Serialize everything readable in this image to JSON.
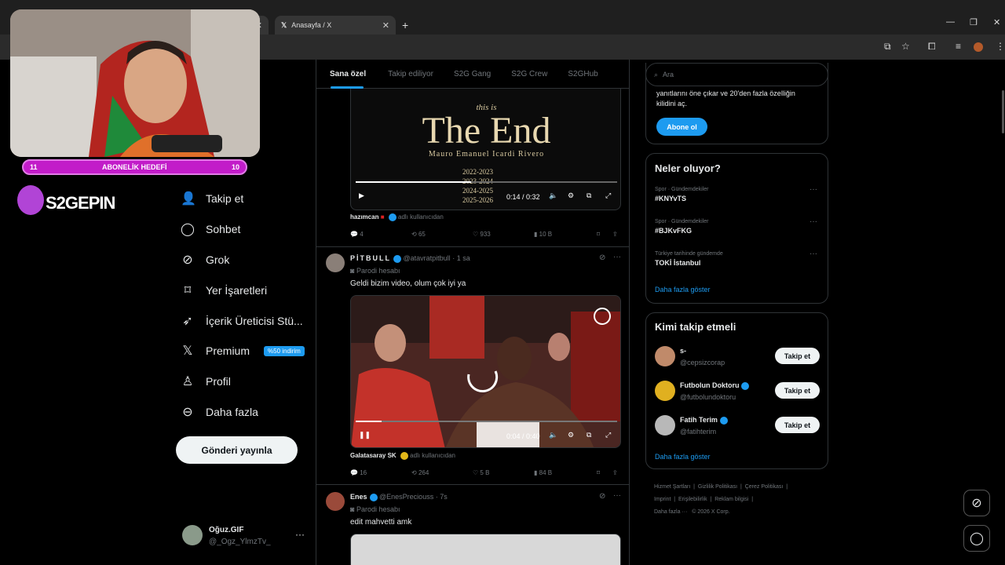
{
  "browser": {
    "tab_title": "Anasayfa / X"
  },
  "overlay": {
    "goal_label": "ABONELİK HEDEFİ",
    "goal_current": "11",
    "goal_target": "10",
    "brand": "S2GEPIN"
  },
  "nav": {
    "items": [
      {
        "label": "Takip et",
        "icon": "add-user-icon"
      },
      {
        "label": "Sohbet",
        "icon": "chat-icon"
      },
      {
        "label": "Grok",
        "icon": "grok-icon"
      },
      {
        "label": "Yer İşaretleri",
        "icon": "bookmark-icon"
      },
      {
        "label": "İçerik Üreticisi Stü...",
        "icon": "rocket-icon"
      },
      {
        "label": "Premium",
        "icon": "x-logo-icon",
        "badge": "%50 indirim"
      },
      {
        "label": "Profil",
        "icon": "person-icon"
      },
      {
        "label": "Daha fazla",
        "icon": "more-circle-icon"
      }
    ],
    "post_button": "Gönderi yayınla",
    "account_name": "Oğuz.GIF",
    "account_handle": "@_Ogz_YlmzTv_"
  },
  "feed": {
    "tabs": [
      "Sana özel",
      "Takip ediliyor",
      "S2G Gang",
      "S2G Crew",
      "S2GHub"
    ],
    "post1": {
      "video_top": "this is",
      "video_title": "The End",
      "video_sub": "Mauro Emanuel Icardi Rivero",
      "years": [
        "2022-2023",
        "2023-2024",
        "2024-2025",
        "2025-2026"
      ],
      "time": "0:14 / 0:32",
      "source_name": "hazımcan",
      "source_suffix": "adlı kullanıcıdan",
      "replies": "4",
      "reposts": "65",
      "likes": "933",
      "views": "10 B"
    },
    "post2": {
      "name": "PİTBULL",
      "handle": "@atavratpitbull",
      "time": "· 1 sa",
      "parody": "Parodi hesabı",
      "text": "Geldi bizim video, olum çok iyi ya",
      "vtime": "0:04 / 0:40",
      "source_name": "Galatasaray SK",
      "source_suffix": "adlı kullanıcıdan",
      "replies": "16",
      "reposts": "264",
      "likes": "5 B",
      "views": "84 B"
    },
    "post3": {
      "name": "Enes",
      "handle": "@EnesPreciouss",
      "time": "· 7s",
      "parody": "Parodi hesabı",
      "text": "edit mahvetti amk"
    }
  },
  "right": {
    "search_placeholder": "Ara",
    "premium_text_1": "yanıtlarını öne çıkar ve 20'den fazla özelliğin",
    "premium_text_2": "kilidini aç.",
    "subscribe": "Abone ol",
    "trends_title": "Neler oluyor?",
    "trends": [
      {
        "cat": "Spor · Gündemdekiler",
        "name": "#KNYvTS"
      },
      {
        "cat": "Spor · Gündemdekiler",
        "name": "#BJKvFKG"
      },
      {
        "cat": "Türkiye tarihinde gündemde",
        "name": "TOKİ İstanbul"
      }
    ],
    "show_more": "Daha fazla göster",
    "who_title": "Kimi takip etmeli",
    "who": [
      {
        "name": "s-",
        "handle": "@cepsizcorap"
      },
      {
        "name": "Futbolun Doktoru",
        "handle": "@futbolundoktoru"
      },
      {
        "name": "Fatih Terim",
        "handle": "@fatihterim"
      }
    ],
    "follow_label": "Takip et",
    "footer": [
      "Hizmet Şartları",
      "Gizlilik Politikası",
      "Çerez Politikası",
      "Imprint",
      "Erişilebilirlik",
      "Reklam bilgisi",
      "Daha fazla ···",
      "© 2026 X Corp."
    ]
  }
}
